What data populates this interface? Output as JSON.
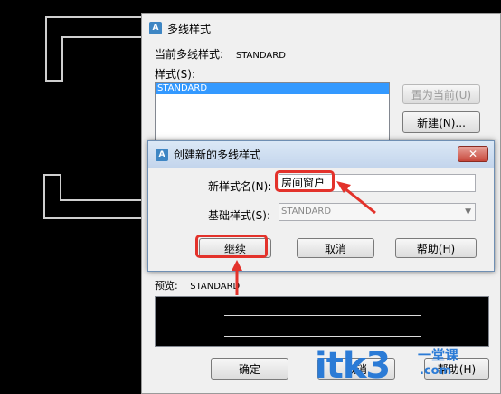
{
  "main_dialog": {
    "title": "多线样式",
    "current_style_label": "当前多线样式:",
    "current_style_value": "STANDARD",
    "styles_label": "样式(S):",
    "styles_list": [
      "STANDARD"
    ],
    "set_current_button": "置为当前(U)",
    "new_button": "新建(N)...",
    "preview_label": "预览:",
    "preview_value": "STANDARD",
    "ok_button": "确定",
    "cancel_button": "取消",
    "help_button": "帮助(H)"
  },
  "new_style_dialog": {
    "title": "创建新的多线样式",
    "name_label": "新样式名(N):",
    "name_value": "房间窗户",
    "base_label": "基础样式(S):",
    "base_value": "STANDARD",
    "continue_button": "继续",
    "cancel_button": "取消",
    "help_button": "帮助(H)",
    "close_glyph": "✕"
  },
  "watermark": {
    "brand": "itk3",
    "domain_suffix": ".com",
    "tagline": "一堂课"
  },
  "colors": {
    "highlight_red": "#e3322b",
    "selection_blue": "#3399ff",
    "watermark_blue": "#2b7bd6"
  }
}
